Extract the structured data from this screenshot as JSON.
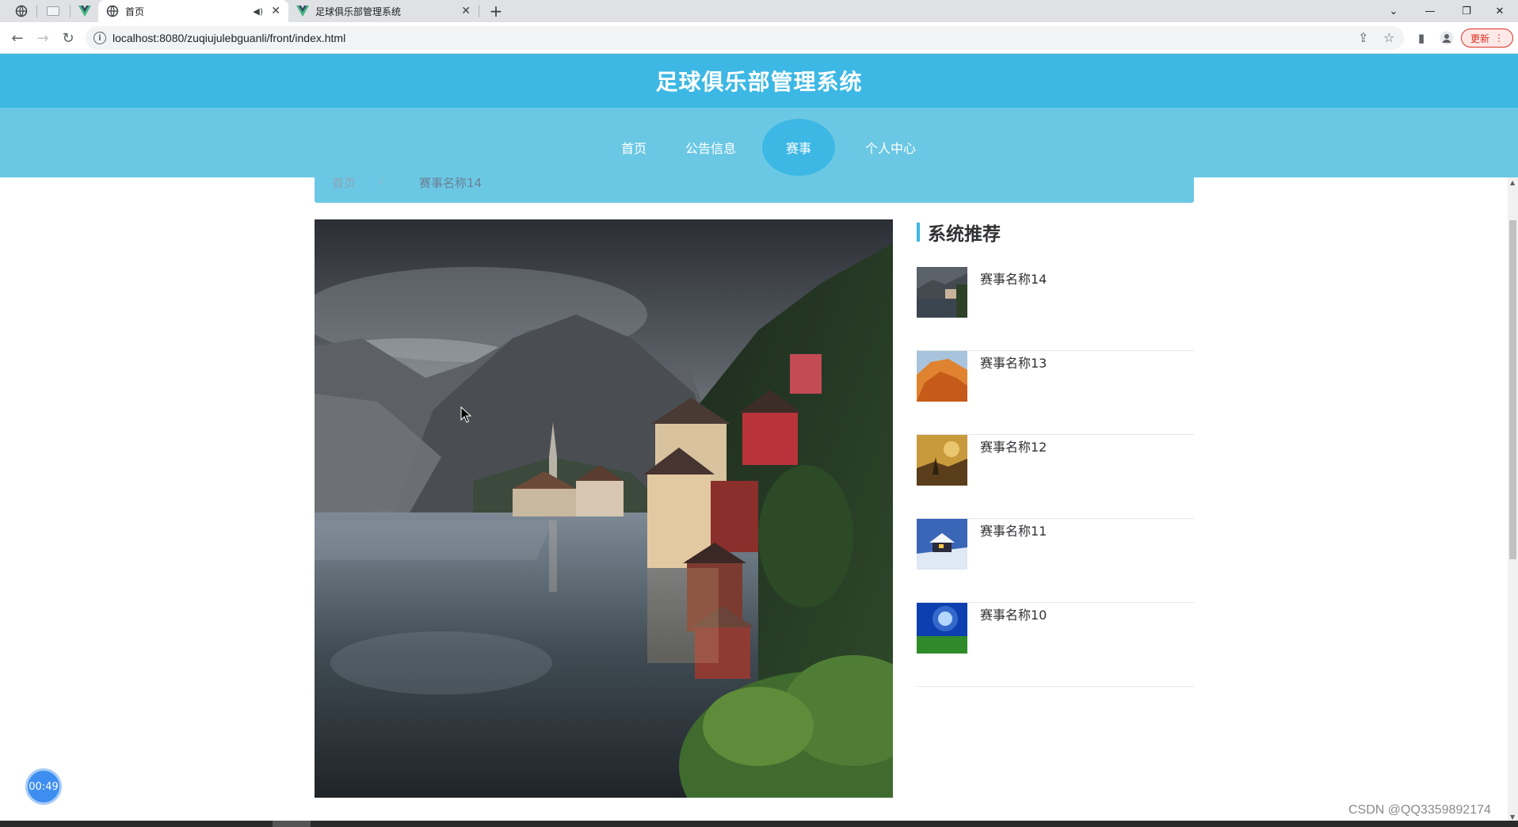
{
  "browser": {
    "tabs": [
      {
        "title": "首页",
        "active": true,
        "audio_icon": "speaker-icon"
      },
      {
        "title": "足球俱乐部管理系统",
        "active": false
      }
    ],
    "url": "localhost:8080/zuqiujulebguanli/front/index.html",
    "update_label": "更新"
  },
  "site": {
    "title": "足球俱乐部管理系统",
    "nav": [
      {
        "label": "首页",
        "active": false
      },
      {
        "label": "公告信息",
        "active": false
      },
      {
        "label": "赛事",
        "active": true
      },
      {
        "label": "个人中心",
        "active": false
      }
    ]
  },
  "breadcrumb": {
    "home": "首页",
    "separator": "/",
    "current": "赛事名称14"
  },
  "sidebar": {
    "title": "系统推荐",
    "items": [
      {
        "name": "赛事名称14",
        "thumb": "lake-village"
      },
      {
        "name": "赛事名称13",
        "thumb": "orange-rock"
      },
      {
        "name": "赛事名称12",
        "thumb": "golden-landscape"
      },
      {
        "name": "赛事名称11",
        "thumb": "snow-cabin"
      },
      {
        "name": "赛事名称10",
        "thumb": "blue-sky-field"
      }
    ]
  },
  "overlay": {
    "timer": "00:49",
    "watermark": "CSDN @QQ3359892174"
  },
  "colors": {
    "header": "#3db8e4",
    "nav": "#6bc8e4",
    "accent": "#3db8e4"
  }
}
